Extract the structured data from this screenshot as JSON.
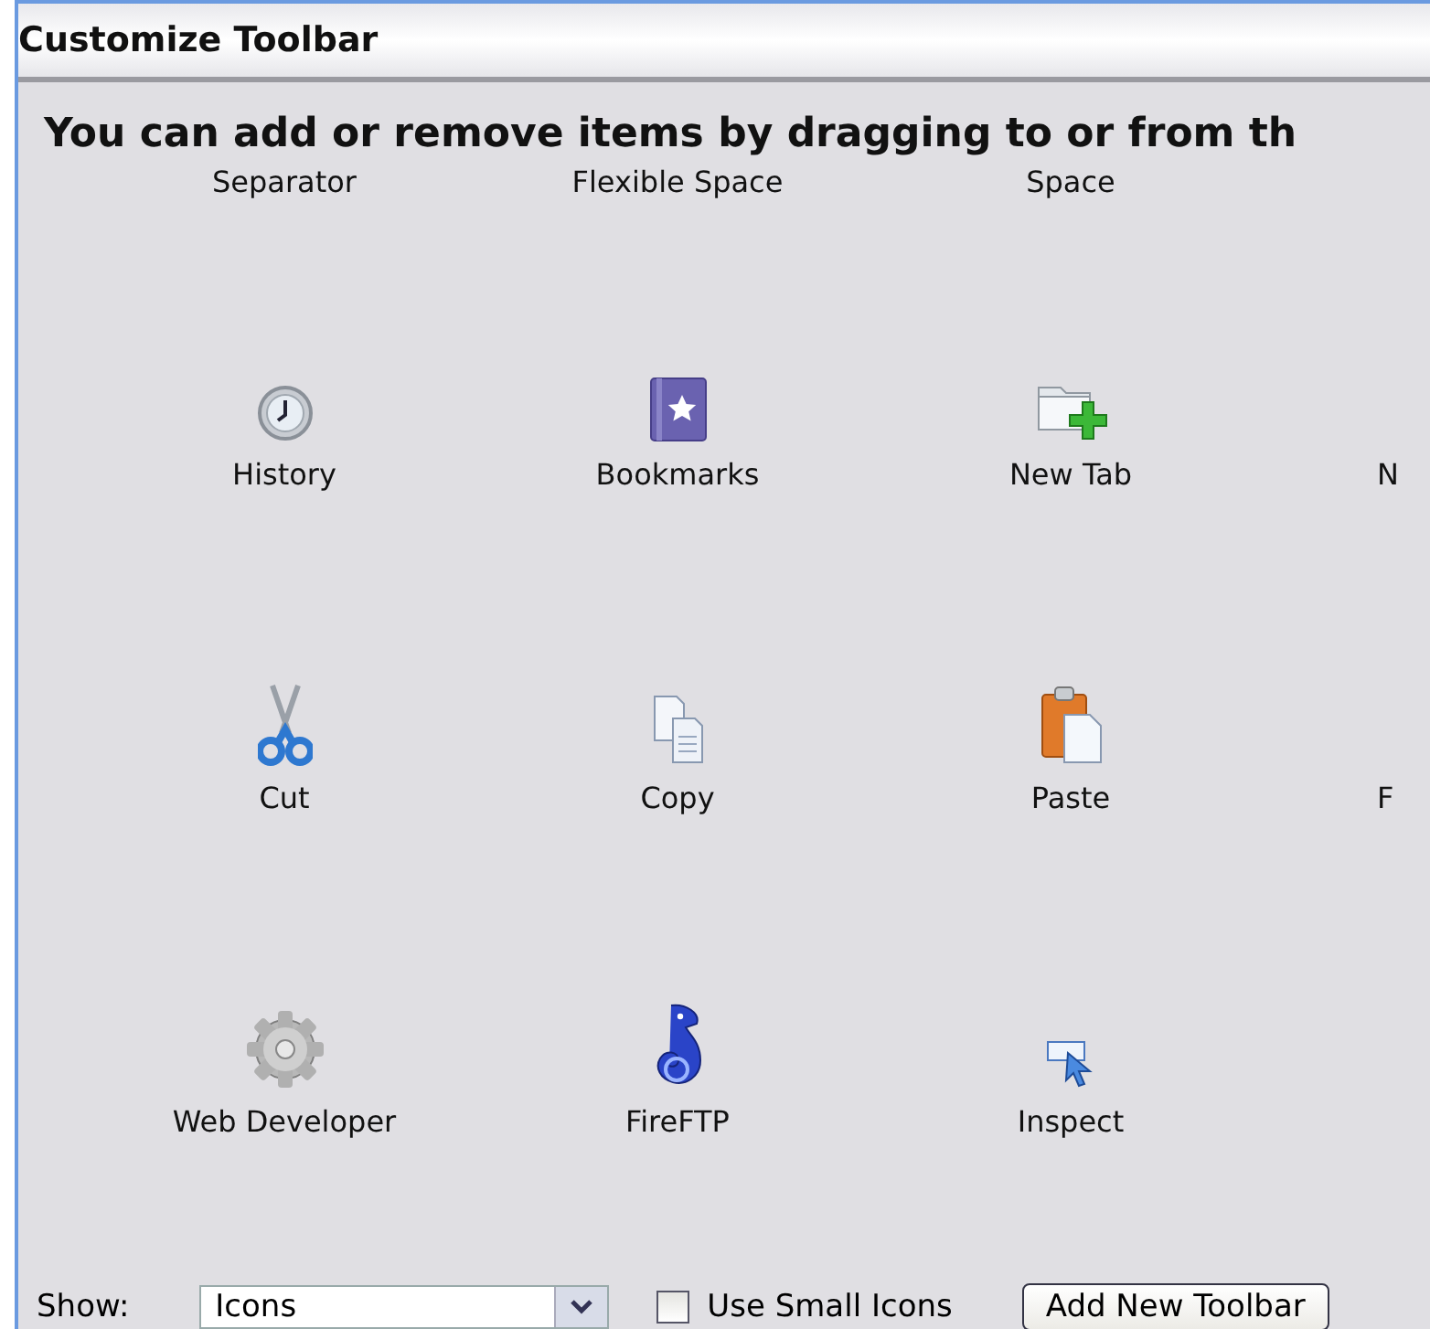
{
  "window": {
    "title": "Customize Toolbar"
  },
  "instruction": "You can add or remove items by dragging to or from th",
  "palette_rows": [
    {
      "items": [
        {
          "label": "Separator",
          "kind": "text"
        },
        {
          "label": "Flexible Space",
          "kind": "text"
        },
        {
          "label": "Space",
          "kind": "text"
        }
      ]
    },
    {
      "items": [
        {
          "label": "History",
          "kind": "clock"
        },
        {
          "label": "Bookmarks",
          "kind": "book"
        },
        {
          "label": "New Tab",
          "kind": "newtab"
        },
        {
          "label": "N",
          "kind": "text"
        }
      ]
    },
    {
      "items": [
        {
          "label": "Cut",
          "kind": "scissors"
        },
        {
          "label": "Copy",
          "kind": "copy"
        },
        {
          "label": "Paste",
          "kind": "paste"
        },
        {
          "label": "F",
          "kind": "text"
        }
      ]
    },
    {
      "items": [
        {
          "label": "Web Developer",
          "kind": "gear"
        },
        {
          "label": "FireFTP",
          "kind": "seahorse"
        },
        {
          "label": "Inspect",
          "kind": "inspect"
        }
      ]
    }
  ],
  "footer": {
    "show_label": "Show:",
    "show_value": "Icons",
    "small_icons": {
      "label": "Use Small Icons",
      "checked": false
    },
    "add_button": "Add New Toolbar"
  }
}
